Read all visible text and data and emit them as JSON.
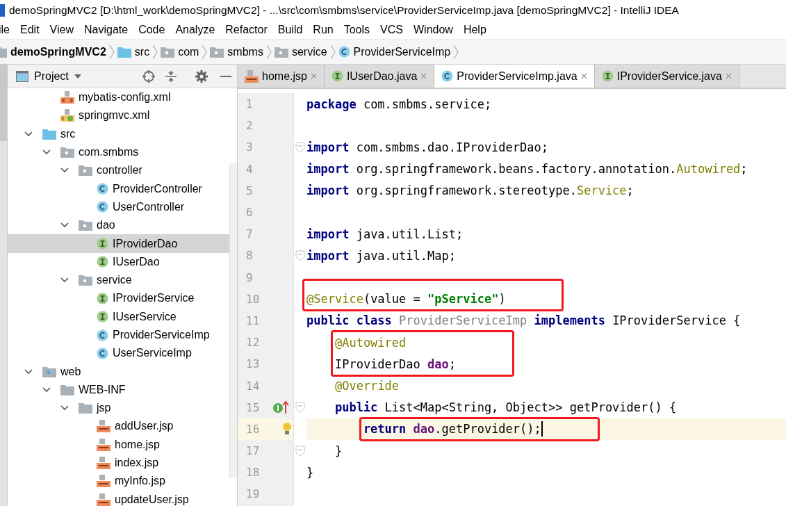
{
  "window": {
    "title": "demoSpringMVC2 [D:\\html_work\\demoSpringMVC2] - ...\\src\\com\\smbms\\service\\ProviderServiceImp.java [demoSpringMVC2] - IntelliJ IDEA"
  },
  "menu": [
    "ile",
    "Edit",
    "View",
    "Navigate",
    "Code",
    "Analyze",
    "Refactor",
    "Build",
    "Run",
    "Tools",
    "VCS",
    "Window",
    "Help"
  ],
  "breadcrumbs": [
    {
      "label": "demoSpringMVC2",
      "kind": "project"
    },
    {
      "label": "src",
      "kind": "source"
    },
    {
      "label": "com",
      "kind": "package"
    },
    {
      "label": "smbms",
      "kind": "package"
    },
    {
      "label": "service",
      "kind": "package"
    },
    {
      "label": "ProviderServiceImp",
      "kind": "class"
    }
  ],
  "project_panel": {
    "title": "Project",
    "scrolled_items": [
      {
        "label": "mybatis-config.xml",
        "kind": "xml",
        "selected": false
      },
      {
        "label": "springmvc.xml",
        "kind": "spring-xml",
        "selected": false
      }
    ],
    "items": [
      {
        "label": "src",
        "kind": "source",
        "expanded": true,
        "selected": false,
        "children": [
          {
            "label": "com.smbms",
            "kind": "package",
            "expanded": true,
            "selected": false,
            "children": [
              {
                "label": "controller",
                "kind": "package",
                "expanded": true,
                "selected": false,
                "children": [
                  {
                    "label": "ProviderController",
                    "kind": "class",
                    "selected": false
                  },
                  {
                    "label": "UserController",
                    "kind": "class",
                    "selected": false
                  }
                ]
              },
              {
                "label": "dao",
                "kind": "package",
                "expanded": true,
                "selected": false,
                "children": [
                  {
                    "label": "IProviderDao",
                    "kind": "interface",
                    "selected": true
                  },
                  {
                    "label": "IUserDao",
                    "kind": "interface",
                    "selected": false
                  }
                ]
              },
              {
                "label": "service",
                "kind": "package",
                "expanded": true,
                "selected": false,
                "children": [
                  {
                    "label": "IProviderService",
                    "kind": "interface",
                    "selected": false
                  },
                  {
                    "label": "IUserService",
                    "kind": "interface",
                    "selected": false
                  },
                  {
                    "label": "ProviderServiceImp",
                    "kind": "class",
                    "selected": false
                  },
                  {
                    "label": "UserServiceImp",
                    "kind": "class",
                    "selected": false
                  }
                ]
              }
            ]
          }
        ]
      },
      {
        "label": "web",
        "kind": "web",
        "expanded": true,
        "selected": false,
        "children": [
          {
            "label": "WEB-INF",
            "kind": "folder",
            "expanded": true,
            "selected": false,
            "children": [
              {
                "label": "jsp",
                "kind": "folder",
                "expanded": true,
                "selected": false,
                "children": [
                  {
                    "label": "addUser.jsp",
                    "kind": "jsp",
                    "selected": false
                  },
                  {
                    "label": "home.jsp",
                    "kind": "jsp",
                    "selected": false
                  },
                  {
                    "label": "index.jsp",
                    "kind": "jsp",
                    "selected": false
                  },
                  {
                    "label": "myInfo.jsp",
                    "kind": "jsp",
                    "selected": false
                  },
                  {
                    "label": "updateUser.jsp",
                    "kind": "jsp",
                    "selected": false
                  }
                ]
              }
            ]
          }
        ]
      }
    ]
  },
  "tabs": [
    {
      "label": "home.jsp",
      "kind": "jsp",
      "selected": false
    },
    {
      "label": "IUserDao.java",
      "kind": "interface",
      "selected": false
    },
    {
      "label": "ProviderServiceImp.java",
      "kind": "class",
      "selected": true
    },
    {
      "label": "IProviderService.java",
      "kind": "interface",
      "selected": false
    }
  ],
  "editor": {
    "lines": [
      {
        "number": "1",
        "tokens": [
          {
            "text": "package",
            "kind": "keyword"
          },
          {
            "text": " com.smbms.service;",
            "kind": "plain"
          }
        ]
      },
      {
        "number": "2"
      },
      {
        "number": "3",
        "fold": true,
        "tokens": [
          {
            "text": "import",
            "kind": "keyword"
          },
          {
            "text": " com.smbms.dao.IProviderDao;",
            "kind": "plain"
          }
        ]
      },
      {
        "number": "4",
        "tokens": [
          {
            "text": "import",
            "kind": "keyword"
          },
          {
            "text": " org.springframework.beans.factory.annotation.",
            "kind": "plain"
          },
          {
            "text": "Autowired",
            "kind": "annotation"
          },
          {
            "text": ";",
            "kind": "plain"
          }
        ]
      },
      {
        "number": "5",
        "tokens": [
          {
            "text": "import",
            "kind": "keyword"
          },
          {
            "text": " org.springframework.stereotype.",
            "kind": "plain"
          },
          {
            "text": "Service",
            "kind": "annotation"
          },
          {
            "text": ";",
            "kind": "plain"
          }
        ]
      },
      {
        "number": "6"
      },
      {
        "number": "7",
        "tokens": [
          {
            "text": "import",
            "kind": "keyword"
          },
          {
            "text": " java.util.List;",
            "kind": "plain"
          }
        ]
      },
      {
        "number": "8",
        "fold": true,
        "tokens": [
          {
            "text": "import",
            "kind": "keyword"
          },
          {
            "text": " java.util.Map;",
            "kind": "plain"
          }
        ]
      },
      {
        "number": "9"
      },
      {
        "number": "10",
        "boxed": true,
        "tokens": [
          {
            "text": "@Service",
            "kind": "annotation"
          },
          {
            "text": "(value = ",
            "kind": "plain"
          },
          {
            "text": "\"pService\"",
            "kind": "string"
          },
          {
            "text": ")",
            "kind": "plain"
          }
        ]
      },
      {
        "number": "11",
        "tokens": [
          {
            "text": "public class",
            "kind": "keyword"
          },
          {
            "text": " ProviderServiceImp",
            "kind": "unused"
          },
          {
            "text": " implements",
            "kind": "keyword"
          },
          {
            "text": " IProviderService {",
            "kind": "plain"
          }
        ]
      },
      {
        "number": "12",
        "boxed": true,
        "tokens": [
          {
            "text": "    @Autowired",
            "kind": "annotation"
          }
        ]
      },
      {
        "number": "13",
        "boxed": true,
        "tokens": [
          {
            "text": "    IProviderDao ",
            "kind": "plain"
          },
          {
            "text": "dao",
            "kind": "field"
          },
          {
            "text": ";",
            "kind": "plain"
          }
        ]
      },
      {
        "number": "14",
        "tokens": [
          {
            "text": "    @Override",
            "kind": "annotation"
          }
        ]
      },
      {
        "number": "15",
        "fold": true,
        "implements_mark": true,
        "tokens": [
          {
            "text": "    public",
            "kind": "keyword"
          },
          {
            "text": " List<Map<String, Object>> getProvider() {",
            "kind": "plain"
          }
        ]
      },
      {
        "number": "16",
        "current": true,
        "bulb": true,
        "boxed": true,
        "tokens": [
          {
            "text": "        return",
            "kind": "keyword"
          },
          {
            "text": " dao",
            "kind": "field"
          },
          {
            "text": ".getProvider();",
            "kind": "plain"
          }
        ]
      },
      {
        "number": "17",
        "fold": true,
        "tokens": [
          {
            "text": "    }",
            "kind": "plain"
          }
        ]
      },
      {
        "number": "18",
        "tokens": [
          {
            "text": "}",
            "kind": "plain"
          }
        ]
      },
      {
        "number": "19"
      }
    ]
  }
}
